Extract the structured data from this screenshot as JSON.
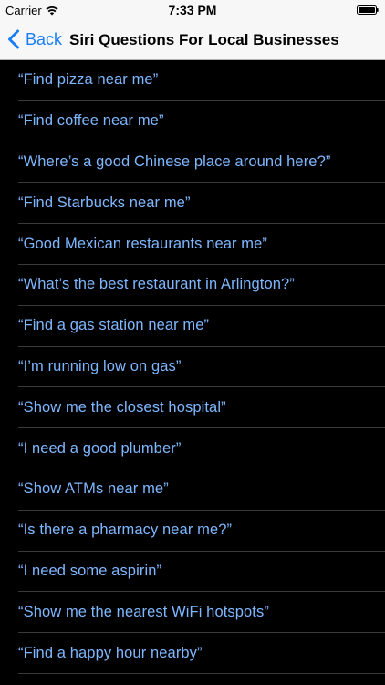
{
  "status_bar": {
    "carrier": "Carrier",
    "time": "7:33 PM",
    "icons": [
      "wifi-icon",
      "battery-icon"
    ]
  },
  "nav": {
    "back_label": "Back",
    "title": "Siri Questions For Local Businesses",
    "back_icon": "chevron-left-icon"
  },
  "colors": {
    "accent": "#1a7ff5",
    "row_text": "#7fb7ff",
    "background": "#000000",
    "nav_background": "#f7f7f8"
  },
  "questions": [
    "“Find pizza near me”",
    "“Find coffee near me”",
    "“Where’s a good Chinese place around here?”",
    "“Find Starbucks near me”",
    "“Good Mexican restaurants near me”",
    "“What’s the best restaurant in Arlington?”",
    "“Find a gas station near me”",
    "“I’m running low on gas”",
    "“Show me the closest hospital”",
    "“I need a good plumber”",
    "“Show ATMs near me”",
    "“Is there a pharmacy near me?”",
    "“I need some aspirin”",
    "“Show me the nearest WiFi hotspots”",
    "“Find a happy hour nearby”"
  ]
}
